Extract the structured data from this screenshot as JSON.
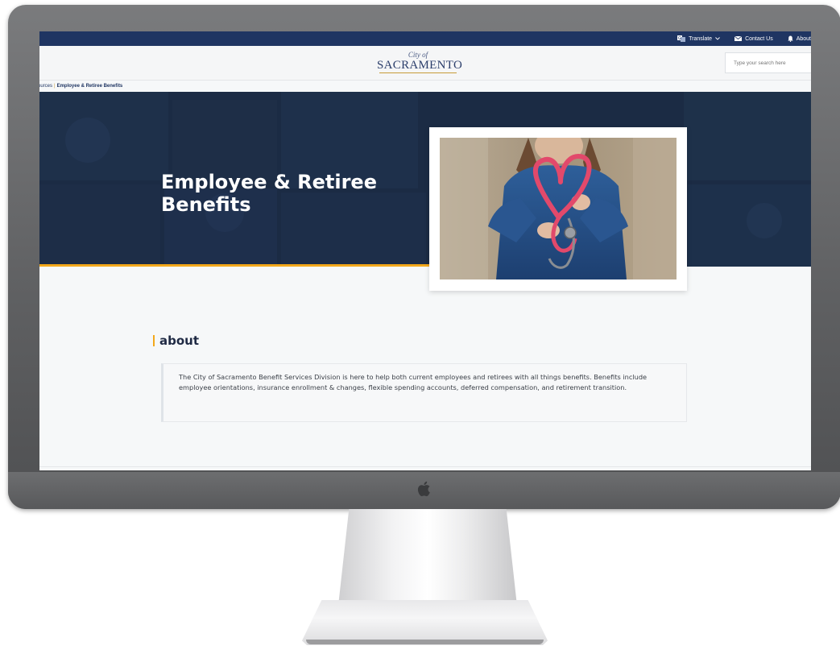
{
  "utility_bar": {
    "translate_label": "Translate",
    "contact_label": "Contact Us",
    "about_label": "About"
  },
  "header": {
    "logo_city_of": "City of",
    "logo_name": "SACRAMENTO",
    "search_placeholder": "Type your search here"
  },
  "breadcrumb": {
    "parent": "ources",
    "current": "Employee & Retiree Benefits"
  },
  "hero": {
    "title": "Employee & Retiree Benefits"
  },
  "about": {
    "heading": "about",
    "body": "The City of Sacramento Benefit Services Division is here to help both current employees and retirees with all things benefits. Benefits include employee orientations, insurance enrollment & changes, flexible spending accounts, deferred compensation, and retirement transition."
  },
  "colors": {
    "navy": "#1f3562",
    "hero_bg": "#1b2b44",
    "accent": "#f3a81b"
  },
  "icons": [
    "translate-icon",
    "chevron-down-icon",
    "mail-icon",
    "bell-icon",
    "apple-logo-icon"
  ]
}
